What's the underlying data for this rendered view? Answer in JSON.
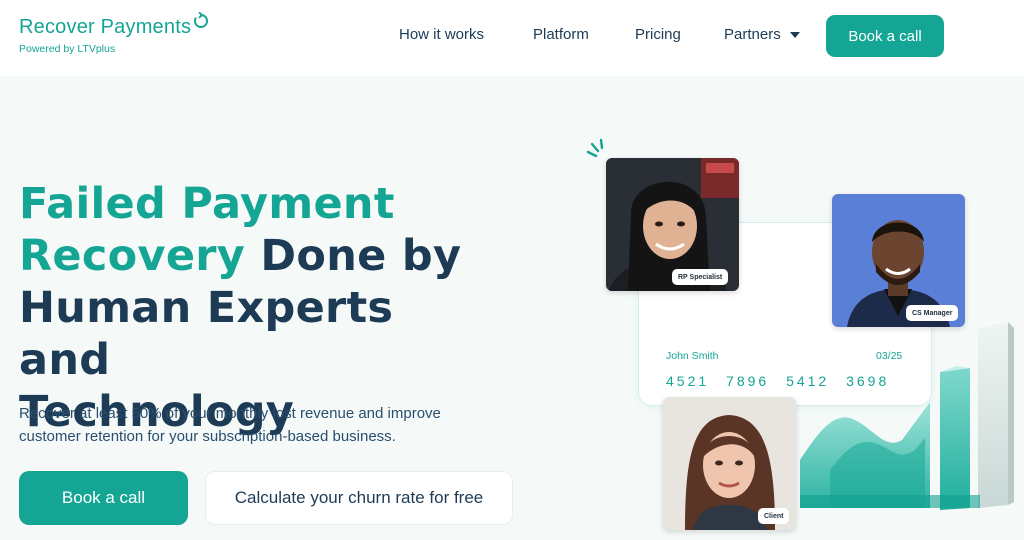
{
  "header": {
    "logo_title": "Recover Payments",
    "logo_subtitle": "Powered by LTVplus",
    "nav": [
      {
        "label": "How it works"
      },
      {
        "label": "Platform"
      },
      {
        "label": "Pricing"
      },
      {
        "label": "Partners",
        "has_dropdown": true
      }
    ],
    "cta_label": "Book a call"
  },
  "hero": {
    "title_accent_line1": "Failed Payment",
    "title_accent_word2": "Recovery",
    "title_rest_line2": " Done by",
    "title_line3": "Human Experts and",
    "title_line4": "Technology",
    "subtitle": "Recover at least 50% of your monthly lost revenue and improve customer retention for your subscription-based business.",
    "primary_cta": "Book a call",
    "secondary_cta": "Calculate your churn rate for free"
  },
  "illustration": {
    "card": {
      "name": "John Smith",
      "expiry": "03/25",
      "number": "4521 7896 5412 3698"
    },
    "people": [
      {
        "role": "RP Specialist"
      },
      {
        "role": "CS Manager"
      },
      {
        "role": "Client"
      }
    ]
  },
  "colors": {
    "brand": "#14a594",
    "navy": "#1d3b55",
    "background": "#f5faf9"
  }
}
